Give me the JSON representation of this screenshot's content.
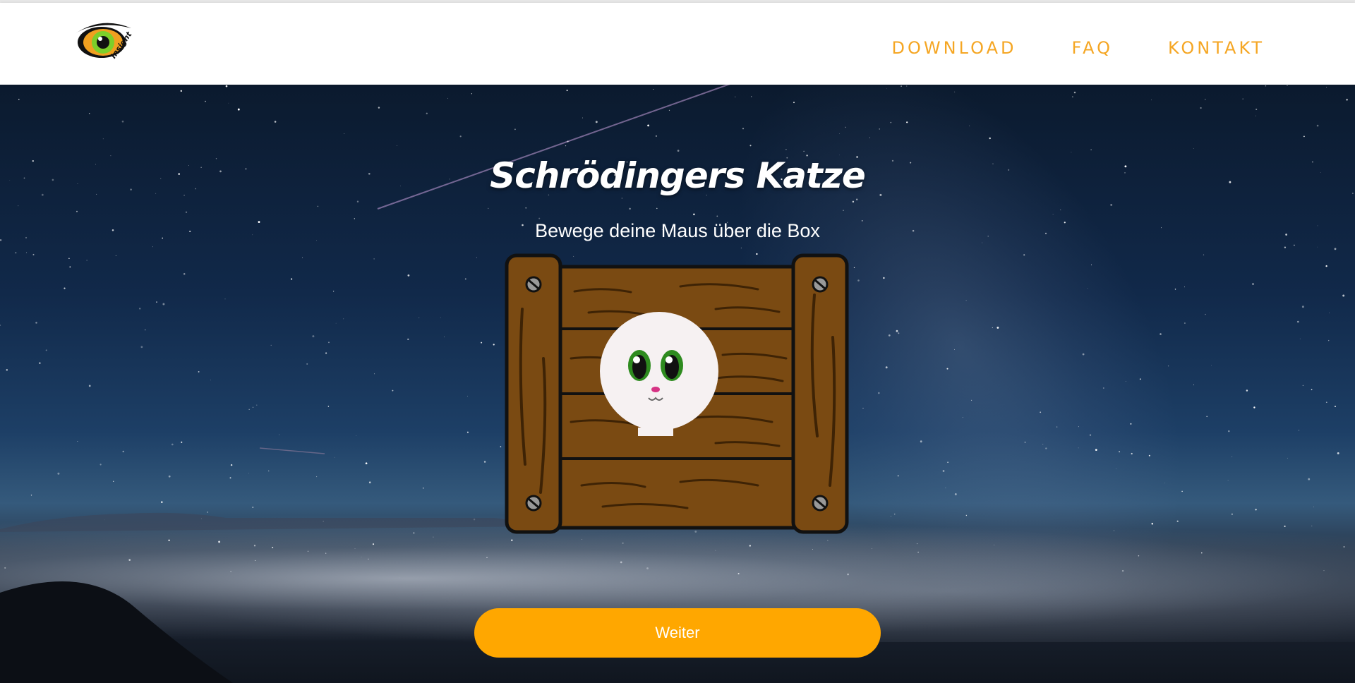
{
  "header": {
    "logo_text": "Insight",
    "nav": [
      {
        "label": "DOWNLOAD"
      },
      {
        "label": "FAQ"
      },
      {
        "label": "KONTAKT"
      }
    ]
  },
  "hero": {
    "title": "Schrödingers Katze",
    "subtitle": "Bewege deine Maus über die Box",
    "button_label": "Weiter"
  },
  "colors": {
    "accent": "#ffa700",
    "nav_text": "#f5a623",
    "wood": "#7a4a12",
    "cat_eye": "#2e8b1f"
  }
}
